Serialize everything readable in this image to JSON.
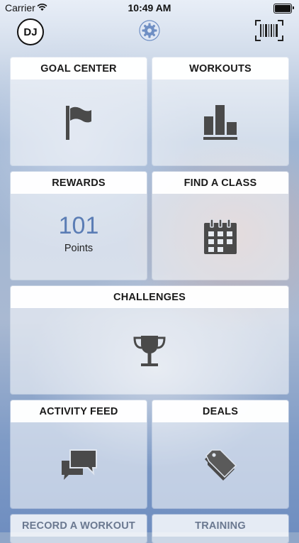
{
  "status_bar": {
    "carrier": "Carrier",
    "time": "10:49 AM",
    "wifi_icon": "wifi-icon",
    "battery_icon": "battery-icon"
  },
  "nav": {
    "avatar_initials": "DJ",
    "settings_icon": "gear-icon",
    "scan_icon": "barcode-icon"
  },
  "tiles": {
    "goal_center": {
      "title": "GOAL CENTER",
      "icon": "flag-icon"
    },
    "workouts": {
      "title": "WORKOUTS",
      "icon": "bar-chart-icon"
    },
    "rewards": {
      "title": "REWARDS",
      "points": "101",
      "points_label": "Points"
    },
    "find_a_class": {
      "title": "FIND A CLASS",
      "icon": "calendar-icon"
    },
    "challenges": {
      "title": "CHALLENGES",
      "icon": "trophy-icon"
    },
    "activity_feed": {
      "title": "ACTIVITY FEED",
      "icon": "chat-bubbles-icon"
    },
    "deals": {
      "title": "DEALS",
      "icon": "tags-icon"
    },
    "record_a_workout": {
      "title": "RECORD A WORKOUT"
    },
    "training": {
      "title": "TRAINING"
    }
  },
  "colors": {
    "accent": "#5b7db5",
    "icon_gray": "#4a4a4a",
    "gear_blue": "#6f8fc4"
  }
}
